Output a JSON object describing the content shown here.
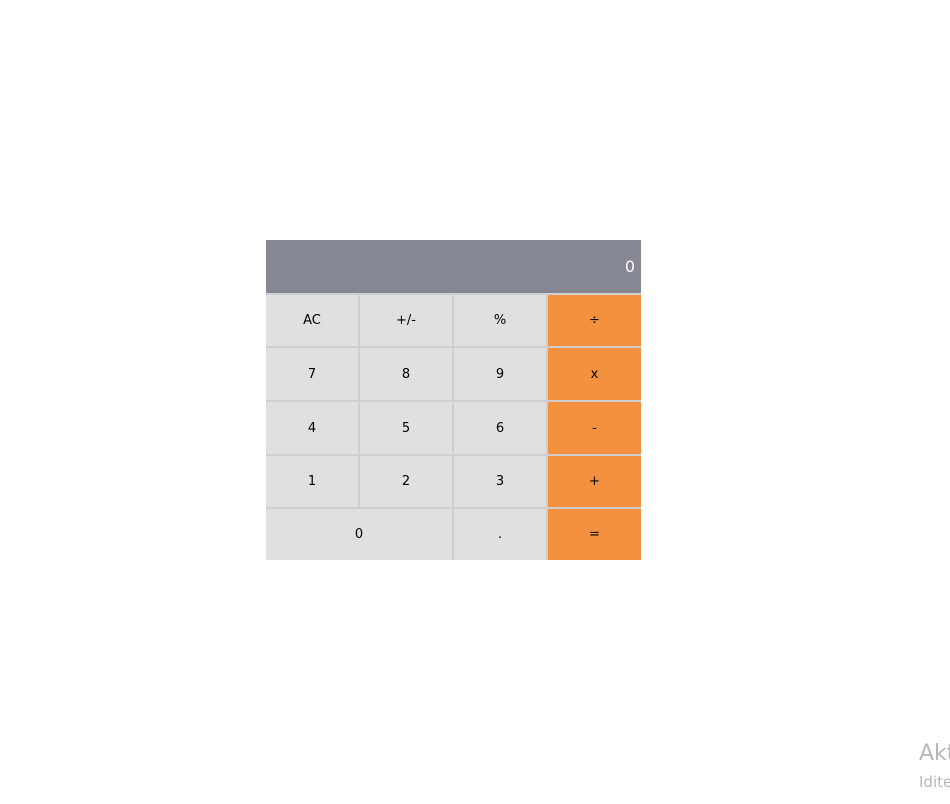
{
  "display": {
    "value": "0"
  },
  "keys": {
    "ac": "AC",
    "sign": "+/-",
    "percent": "%",
    "divide": "÷",
    "seven": "7",
    "eight": "8",
    "nine": "9",
    "multiply": "x",
    "four": "4",
    "five": "5",
    "six": "6",
    "subtract": "-",
    "one": "1",
    "two": "2",
    "three": "3",
    "add": "+",
    "zero": "0",
    "decimal": ".",
    "equals": "="
  },
  "colors": {
    "display_bg": "#858793",
    "key_bg": "#e0e0e0",
    "operator_bg": "#f4913e"
  },
  "watermark": {
    "title": "Akt",
    "subtitle": "Idite"
  }
}
